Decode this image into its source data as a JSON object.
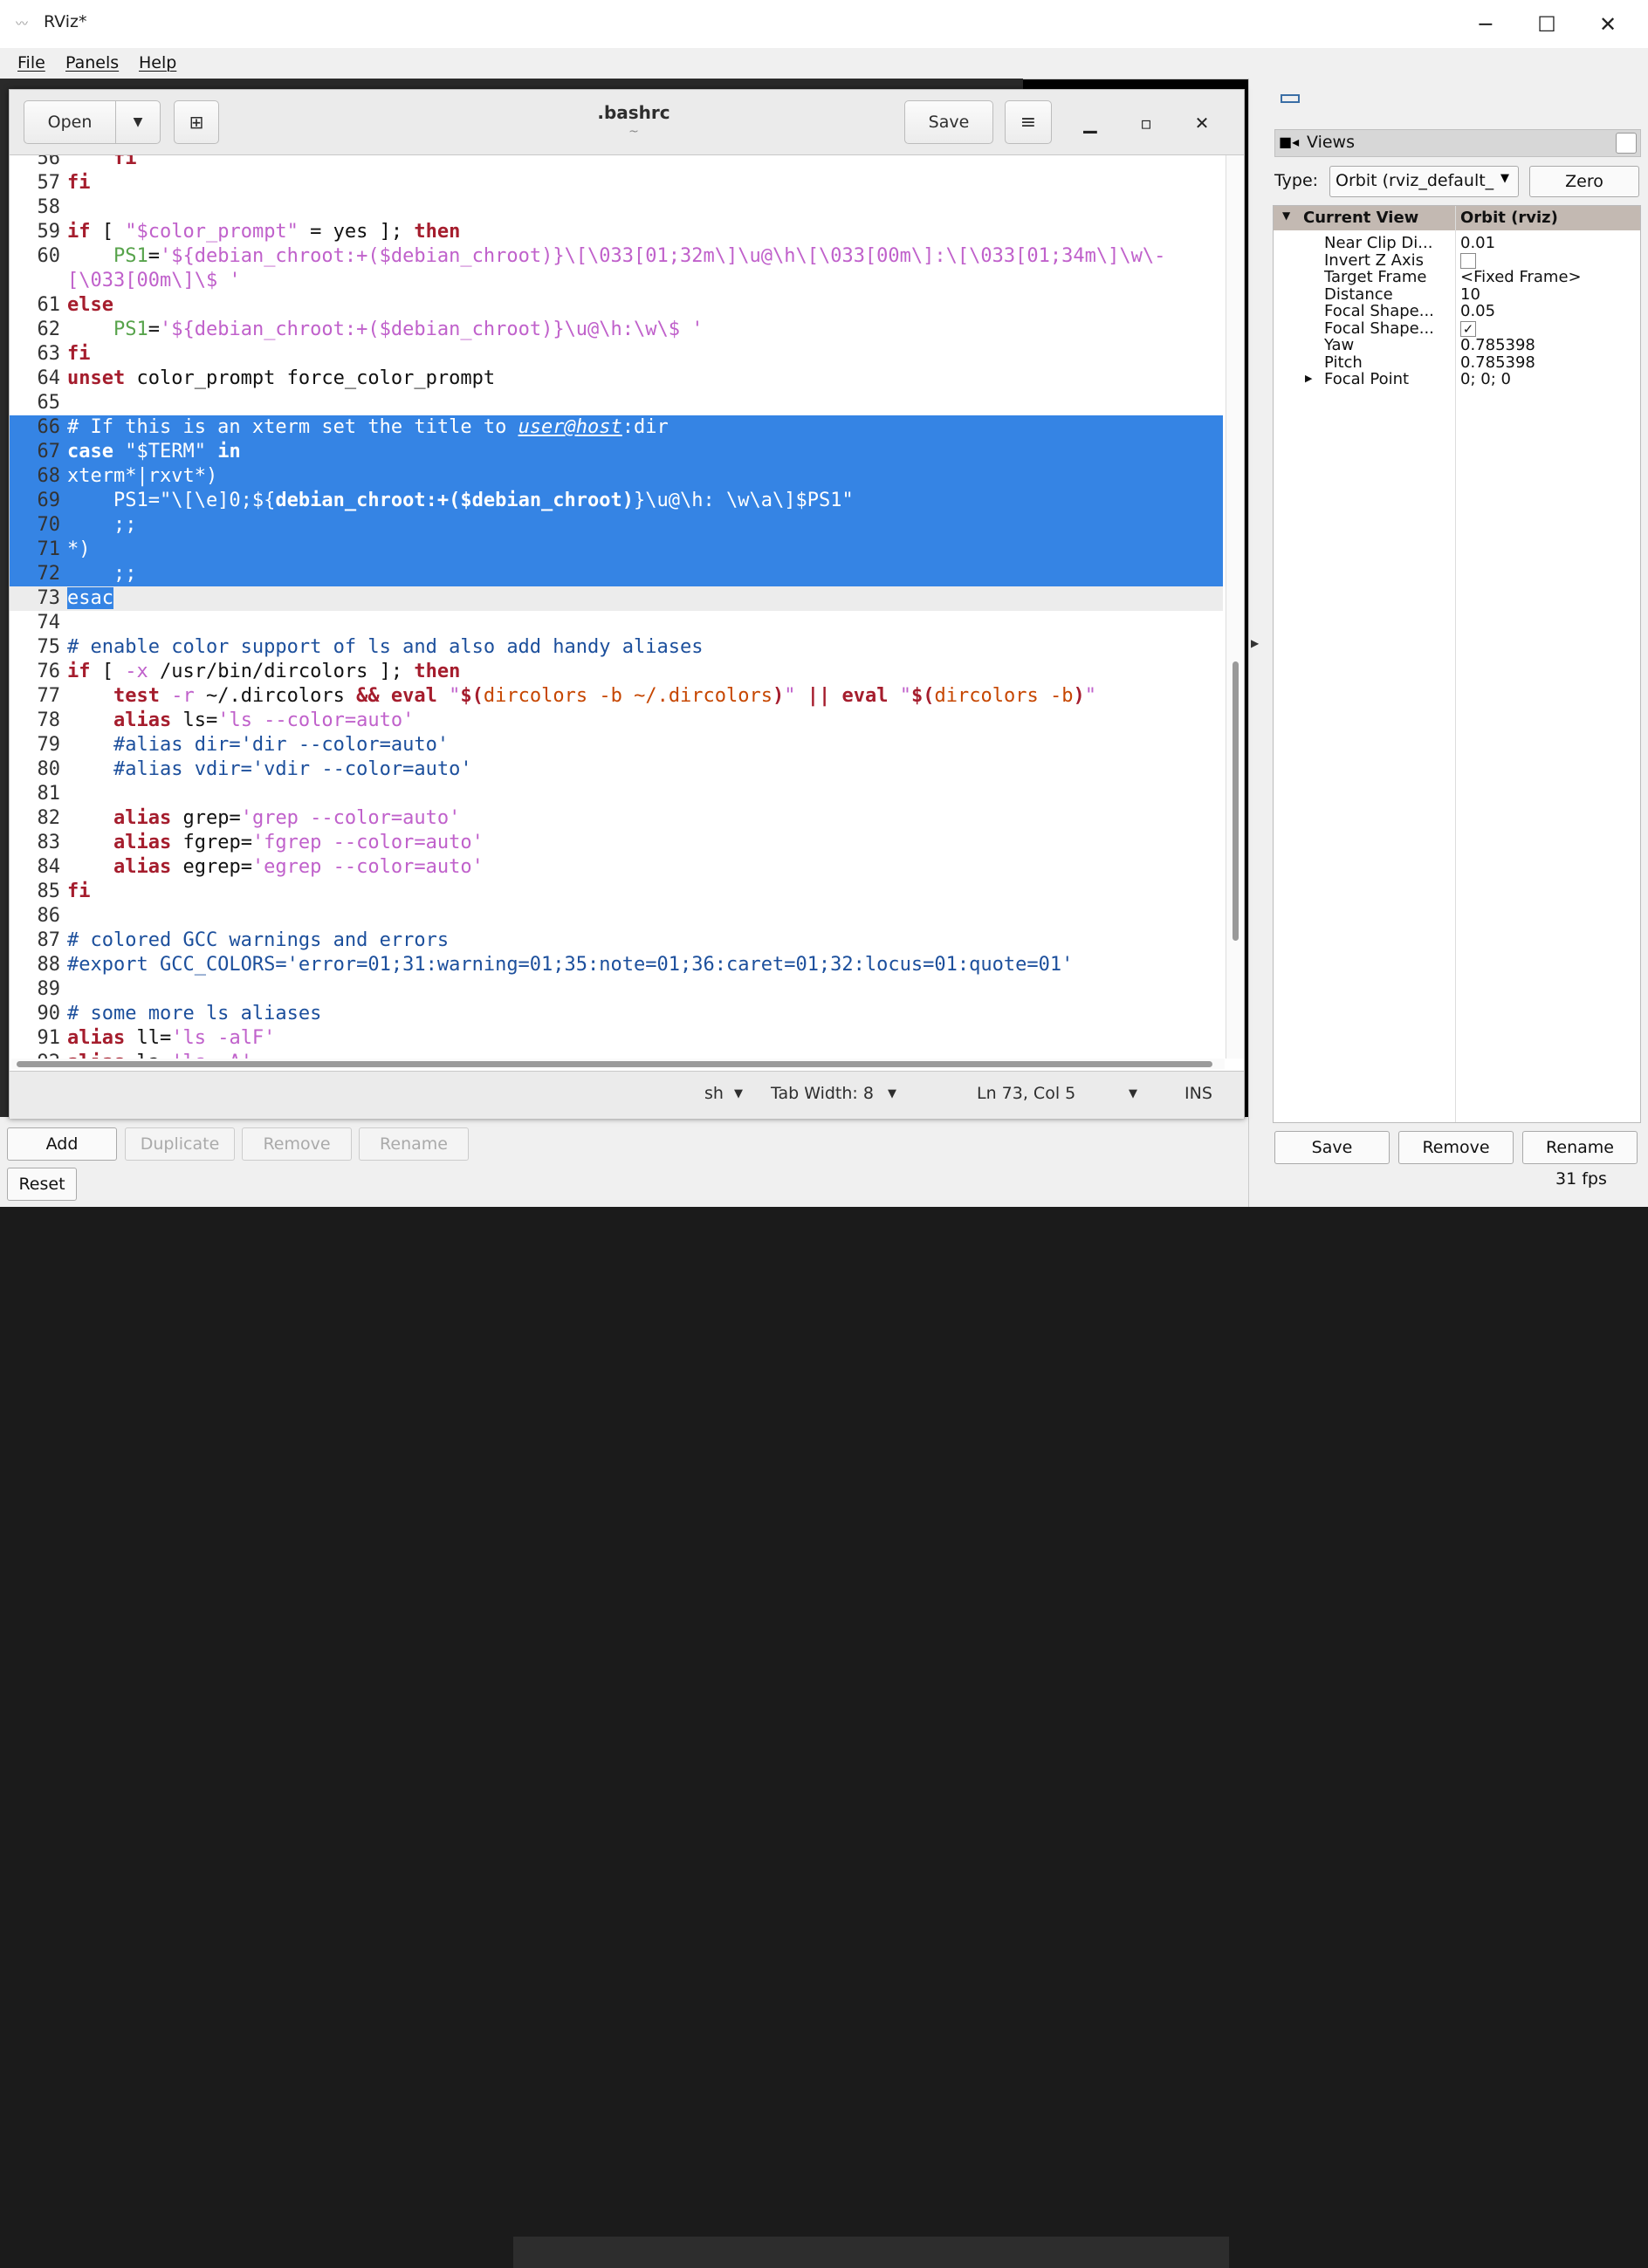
{
  "window": {
    "title": "RViz*",
    "minimize": "─",
    "maximize": "☐",
    "close": "✕"
  },
  "menu": [
    "File",
    "Panels",
    "Help"
  ],
  "editor": {
    "title": ".bashrc",
    "subtitle": "~",
    "open_label": "Open",
    "save_label": "Save",
    "status": {
      "lang": "sh",
      "tab_width": "Tab Width: 8",
      "position": "Ln 73, Col 5",
      "mode": "INS"
    }
  },
  "lines": [
    {
      "no": "56",
      "segs": [
        {
          "t": "    "
        },
        {
          "t": "fi",
          "c": "kw"
        }
      ]
    },
    {
      "no": "57",
      "segs": [
        {
          "t": "fi",
          "c": "kw"
        }
      ]
    },
    {
      "no": "58",
      "segs": []
    },
    {
      "no": "59",
      "segs": [
        {
          "t": "if",
          "c": "kw"
        },
        {
          "t": " [ "
        },
        {
          "t": "\"$color_prompt\"",
          "c": "str"
        },
        {
          "t": " = yes ]; "
        },
        {
          "t": "then",
          "c": "kw"
        }
      ]
    },
    {
      "no": "60",
      "segs": [
        {
          "t": "    "
        },
        {
          "t": "PS1",
          "c": "var"
        },
        {
          "t": "="
        },
        {
          "t": "'${debian_chroot:+($debian_chroot)}\\[\\033[01;32m\\]\\u@\\h\\[\\033[00m\\]:\\[\\033[01;34m\\]\\w\\-",
          "c": "str"
        }
      ]
    },
    {
      "no": "",
      "segs": [
        {
          "t": "[\\033[00m\\]\\$ '",
          "c": "str"
        }
      ]
    },
    {
      "no": "61",
      "segs": [
        {
          "t": "else",
          "c": "kw"
        }
      ]
    },
    {
      "no": "62",
      "segs": [
        {
          "t": "    "
        },
        {
          "t": "PS1",
          "c": "var"
        },
        {
          "t": "="
        },
        {
          "t": "'${debian_chroot:+($debian_chroot)}\\u@\\h:\\w\\$ '",
          "c": "str"
        }
      ]
    },
    {
      "no": "63",
      "segs": [
        {
          "t": "fi",
          "c": "kw"
        }
      ]
    },
    {
      "no": "64",
      "segs": [
        {
          "t": "unset",
          "c": "kw"
        },
        {
          "t": " color_prompt force_color_prompt"
        }
      ]
    },
    {
      "no": "65",
      "segs": []
    },
    {
      "no": "66",
      "sel": true,
      "segs": [
        {
          "t": "# If this is an xterm set the title to "
        },
        {
          "t": "user@host",
          "u": true
        },
        {
          "t": ":dir"
        }
      ]
    },
    {
      "no": "67",
      "sel": true,
      "segs": [
        {
          "t": "case",
          "b": true
        },
        {
          "t": " \"$TERM\" "
        },
        {
          "t": "in",
          "b": true
        }
      ]
    },
    {
      "no": "68",
      "sel": true,
      "segs": [
        {
          "t": "xterm*|rxvt*)"
        }
      ]
    },
    {
      "no": "69",
      "sel": true,
      "segs": [
        {
          "t": "    PS1=\"\\[\\e]0;${"
        },
        {
          "t": "debian_chroot:+($debian_chroot)",
          "b": true
        },
        {
          "t": "}\\u@\\h: \\w\\a\\]$PS1\""
        }
      ]
    },
    {
      "no": "70",
      "sel": true,
      "segs": [
        {
          "t": "    ;;"
        }
      ]
    },
    {
      "no": "71",
      "sel": true,
      "segs": [
        {
          "t": "*)"
        }
      ]
    },
    {
      "no": "72",
      "sel": true,
      "segs": [
        {
          "t": "    ;;"
        }
      ]
    },
    {
      "no": "73",
      "cur": true,
      "segs": [
        {
          "t": "esac",
          "c": "selword"
        }
      ]
    },
    {
      "no": "74",
      "segs": []
    },
    {
      "no": "75",
      "segs": [
        {
          "t": "# enable color support of ls and also add handy aliases",
          "c": "cm"
        }
      ]
    },
    {
      "no": "76",
      "segs": [
        {
          "t": "if",
          "c": "kw"
        },
        {
          "t": " [ "
        },
        {
          "t": "-x",
          "c": "str"
        },
        {
          "t": " /usr/bin/dircolors ]; "
        },
        {
          "t": "then",
          "c": "kw"
        }
      ]
    },
    {
      "no": "77",
      "segs": [
        {
          "t": "    "
        },
        {
          "t": "test",
          "c": "kw"
        },
        {
          "t": " "
        },
        {
          "t": "-r",
          "c": "str"
        },
        {
          "t": " ~/.dircolors "
        },
        {
          "t": "&&",
          "c": "kw"
        },
        {
          "t": " "
        },
        {
          "t": "eval",
          "c": "kw"
        },
        {
          "t": " "
        },
        {
          "t": "\"",
          "c": "str"
        },
        {
          "t": "$(",
          "c": "kw"
        },
        {
          "t": "dircolors -b ~/.dircolors",
          "c": "op"
        },
        {
          "t": ")",
          "c": "kw"
        },
        {
          "t": "\"",
          "c": "str"
        },
        {
          "t": " "
        },
        {
          "t": "||",
          "c": "kw"
        },
        {
          "t": " "
        },
        {
          "t": "eval",
          "c": "kw"
        },
        {
          "t": " "
        },
        {
          "t": "\"",
          "c": "str"
        },
        {
          "t": "$(",
          "c": "kw"
        },
        {
          "t": "dircolors -b",
          "c": "op"
        },
        {
          "t": ")",
          "c": "kw"
        },
        {
          "t": "\"",
          "c": "str"
        }
      ]
    },
    {
      "no": "78",
      "segs": [
        {
          "t": "    "
        },
        {
          "t": "alias",
          "c": "kw"
        },
        {
          "t": " ls="
        },
        {
          "t": "'ls --color=auto'",
          "c": "str"
        }
      ]
    },
    {
      "no": "79",
      "segs": [
        {
          "t": "    #alias dir='dir --color=auto'",
          "c": "cm"
        }
      ]
    },
    {
      "no": "80",
      "segs": [
        {
          "t": "    #alias vdir='vdir --color=auto'",
          "c": "cm"
        }
      ]
    },
    {
      "no": "81",
      "segs": []
    },
    {
      "no": "82",
      "segs": [
        {
          "t": "    "
        },
        {
          "t": "alias",
          "c": "kw"
        },
        {
          "t": " grep="
        },
        {
          "t": "'grep --color=auto'",
          "c": "str"
        }
      ]
    },
    {
      "no": "83",
      "segs": [
        {
          "t": "    "
        },
        {
          "t": "alias",
          "c": "kw"
        },
        {
          "t": " fgrep="
        },
        {
          "t": "'fgrep --color=auto'",
          "c": "str"
        }
      ]
    },
    {
      "no": "84",
      "segs": [
        {
          "t": "    "
        },
        {
          "t": "alias",
          "c": "kw"
        },
        {
          "t": " egrep="
        },
        {
          "t": "'egrep --color=auto'",
          "c": "str"
        }
      ]
    },
    {
      "no": "85",
      "segs": [
        {
          "t": "fi",
          "c": "kw"
        }
      ]
    },
    {
      "no": "86",
      "segs": []
    },
    {
      "no": "87",
      "segs": [
        {
          "t": "# colored GCC warnings and errors",
          "c": "cm"
        }
      ]
    },
    {
      "no": "88",
      "segs": [
        {
          "t": "#export GCC_COLORS='error=01;31:warning=01;35:note=01;36:caret=01;32:locus=01:quote=01'",
          "c": "cm"
        }
      ]
    },
    {
      "no": "89",
      "segs": []
    },
    {
      "no": "90",
      "segs": [
        {
          "t": "# some more ls aliases",
          "c": "cm"
        }
      ]
    },
    {
      "no": "91",
      "segs": [
        {
          "t": "alias",
          "c": "kw"
        },
        {
          "t": " ll="
        },
        {
          "t": "'ls -alF'",
          "c": "str"
        }
      ]
    },
    {
      "no": "92",
      "segs": [
        {
          "t": "alias",
          "c": "kw"
        },
        {
          "t": " la="
        },
        {
          "t": "'ls -A'",
          "c": "str"
        }
      ]
    }
  ],
  "tool_buttons": {
    "add": "Add",
    "duplicate": "Duplicate",
    "remove": "Remove",
    "rename": "Rename",
    "reset": "Reset"
  },
  "views": {
    "header": "Views",
    "type_label": "Type:",
    "type_value": "Orbit (rviz_default_",
    "zero_label": "Zero",
    "tree_header": {
      "col1": "Current View",
      "col2": "Orbit (rviz)"
    },
    "props": [
      {
        "name": "Near Clip Di...",
        "value": "0.01"
      },
      {
        "name": "Invert Z Axis",
        "value": "",
        "checkbox": "unchecked"
      },
      {
        "name": "Target Frame",
        "value": "<Fixed Frame>"
      },
      {
        "name": "Distance",
        "value": "10"
      },
      {
        "name": "Focal Shape...",
        "value": "0.05"
      },
      {
        "name": "Focal Shape...",
        "value": "",
        "checkbox": "checked"
      },
      {
        "name": "Yaw",
        "value": "0.785398"
      },
      {
        "name": "Pitch",
        "value": "0.785398"
      },
      {
        "name": "Focal Point",
        "value": "0; 0; 0",
        "expandable": true
      }
    ],
    "save": "Save",
    "remove": "Remove",
    "rename": "Rename"
  },
  "fps": "31 fps",
  "colors": {
    "selection": "#3584e4",
    "keyword": "#a51d2d",
    "string": "#c061cb",
    "comment": "#1c4f9c",
    "variable": "#57a34b"
  }
}
